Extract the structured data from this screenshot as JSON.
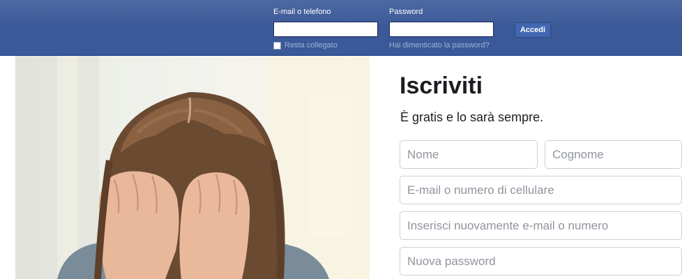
{
  "header": {
    "email_label": "E-mail o telefono",
    "password_label": "Password",
    "login_button": "Accedi",
    "keep_logged_label": "Resta collegato",
    "forgot_link": "Hai dimenticato la password?",
    "email_value": "",
    "password_value": ""
  },
  "signup": {
    "title": "Iscriviti",
    "subtitle": "È gratis e lo sarà sempre.",
    "first_name_placeholder": "Nome",
    "last_name_placeholder": "Cognome",
    "email_placeholder": "E-mail o numero di cellulare",
    "reenter_email_placeholder": "Inserisci nuovamente e-mail o numero",
    "password_placeholder": "Nuova password"
  },
  "colors": {
    "header_blue": "#3b5998",
    "button_blue": "#4267b2",
    "link_light_blue": "#9cb4d8",
    "text_dark": "#1c1e21",
    "placeholder_gray": "#90949c"
  }
}
